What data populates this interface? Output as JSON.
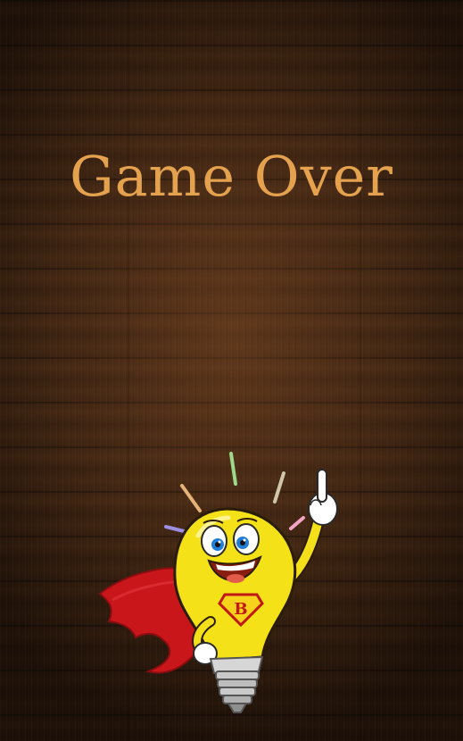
{
  "game": {
    "title": "Game Over",
    "title_color": "#e4a24f",
    "background": "dark-wood-planks",
    "mascot": {
      "name": "superhero-lightbulb-mascot",
      "badge_letter": "B"
    }
  }
}
